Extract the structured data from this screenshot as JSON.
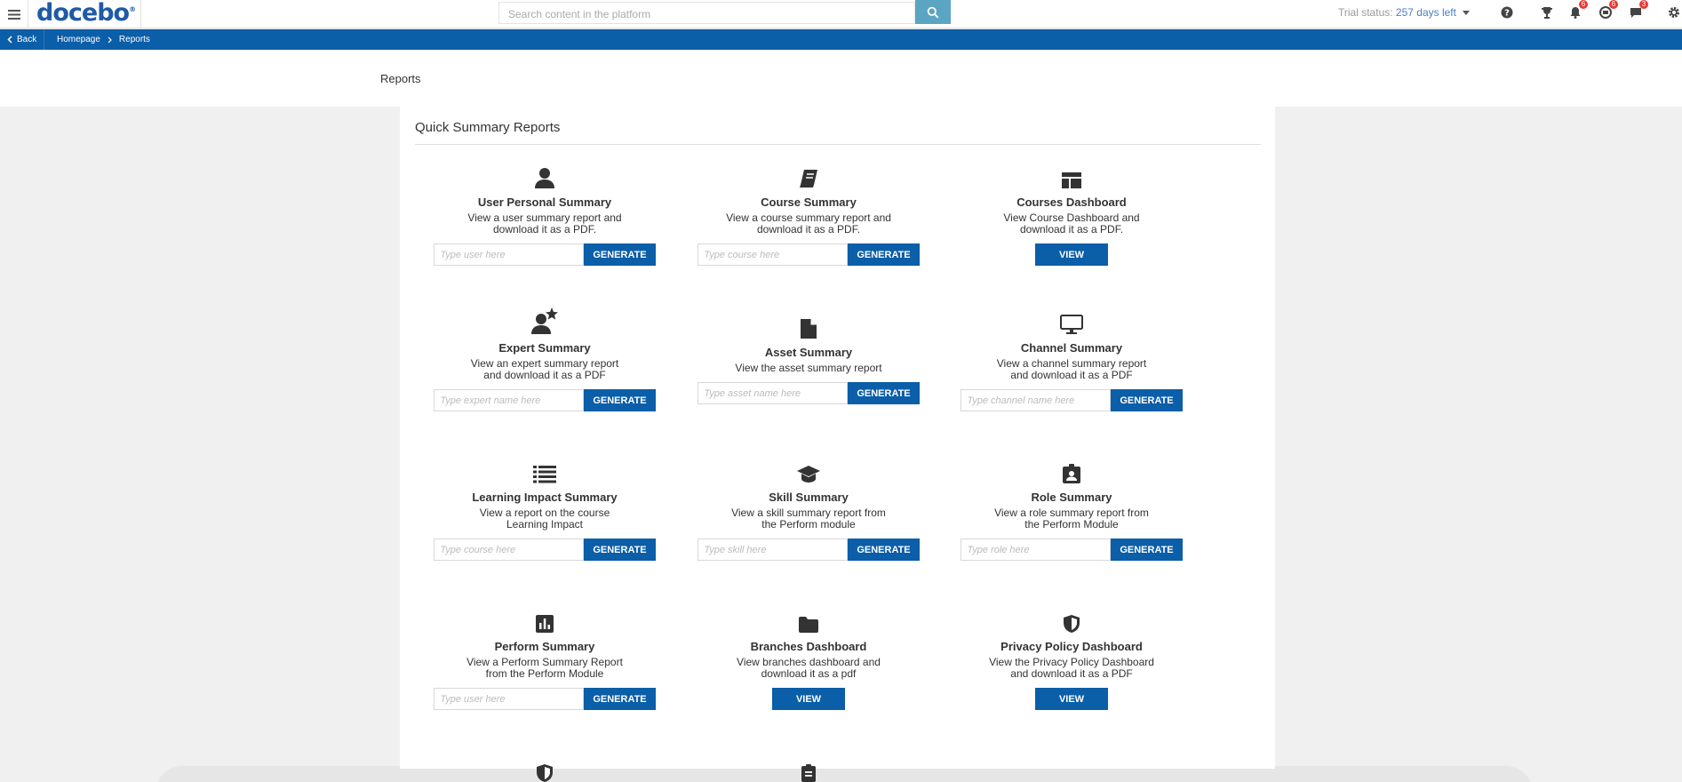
{
  "header": {
    "logo": "docebo",
    "logo_mark": "®",
    "search_placeholder": "Search content in the platform",
    "trial_label": "Trial status:",
    "trial_days": "257 days left",
    "notifications_count": "6",
    "messages_count": "6",
    "chat_count": "3"
  },
  "breadcrumb": {
    "back": "Back",
    "items": [
      "Homepage",
      "Reports"
    ]
  },
  "page": {
    "title": "Reports",
    "section_title": "Quick Summary Reports"
  },
  "tiles": [
    {
      "title": "User Personal Summary",
      "desc1": "View a user summary report and",
      "desc2": "download it as a PDF.",
      "placeholder": "Type user here",
      "button": "GENERATE",
      "icon": "user-icon"
    },
    {
      "title": "Course Summary",
      "desc1": "View a course summary report and",
      "desc2": "download it as a PDF.",
      "placeholder": "Type course here",
      "button": "GENERATE",
      "icon": "book-icon"
    },
    {
      "title": "Courses Dashboard",
      "desc1": "View Course Dashboard and",
      "desc2": "download it as a PDF.",
      "button": "VIEW",
      "icon": "dashboard-icon"
    },
    {
      "title": "Expert Summary",
      "desc1": "View an expert summary report",
      "desc2": "and download it as a PDF",
      "placeholder": "Type expert name here",
      "button": "GENERATE",
      "icon": "expert-icon"
    },
    {
      "title": "Asset Summary",
      "desc1": "View the asset summary report",
      "placeholder": "Type asset name here",
      "button": "GENERATE",
      "icon": "file-icon"
    },
    {
      "title": "Channel Summary",
      "desc1": "View a channel summary report",
      "desc2": "and download it as a PDF",
      "placeholder": "Type channel name here",
      "button": "GENERATE",
      "icon": "monitor-icon"
    },
    {
      "title": "Learning Impact Summary",
      "desc1": "View a report on the course",
      "desc2": "Learning Impact",
      "placeholder": "Type course here",
      "button": "GENERATE",
      "icon": "list-icon"
    },
    {
      "title": "Skill Summary",
      "desc1": "View a skill summary report from",
      "desc2": "the Perform module",
      "placeholder": "Type skill here",
      "button": "GENERATE",
      "icon": "graduation-cap-icon"
    },
    {
      "title": "Role Summary",
      "desc1": "View a role summary report from",
      "desc2": "the Perform Module",
      "placeholder": "Type role here",
      "button": "GENERATE",
      "icon": "id-badge-icon"
    },
    {
      "title": "Perform Summary",
      "desc1": "View a Perform Summary Report",
      "desc2": "from the Perform Module",
      "placeholder": "Type user here",
      "button": "GENERATE",
      "icon": "bar-chart-icon"
    },
    {
      "title": "Branches Dashboard",
      "desc1": "View branches dashboard and",
      "desc2": "download it as a pdf",
      "button": "VIEW",
      "icon": "folder-icon"
    },
    {
      "title": "Privacy Policy Dashboard",
      "desc1": "View the Privacy Policy Dashboard",
      "desc2": "and download it as a PDF",
      "button": "VIEW",
      "icon": "shield-icon"
    }
  ],
  "colors": {
    "primary": "#0b5ea8",
    "search_button": "#5aa5c2",
    "badge": "#e53935",
    "logo": "#1f5aa6"
  }
}
